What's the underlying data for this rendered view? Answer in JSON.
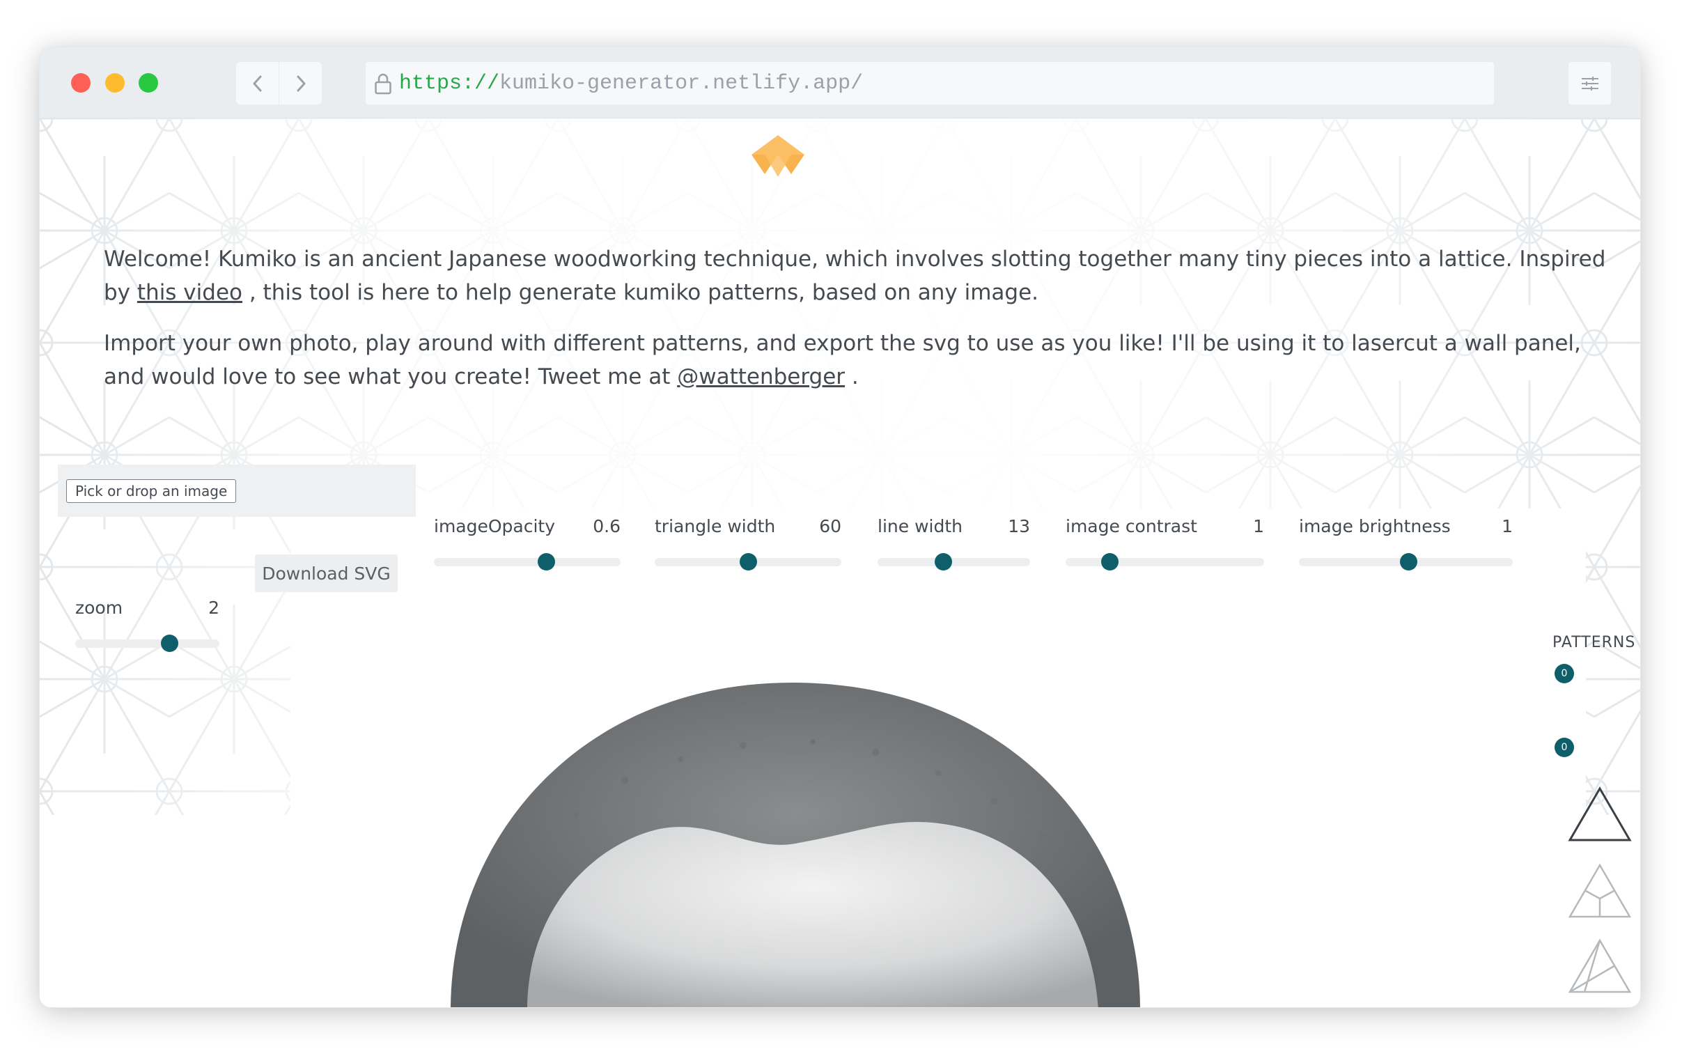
{
  "browser": {
    "url_scheme": "https://",
    "url_host": "kumiko-generator.netlify.app/"
  },
  "intro": {
    "p1_before_link": "Welcome! Kumiko is an ancient Japanese woodworking technique, which involves slotting together many tiny pieces into a lattice. Inspired by ",
    "p1_link": "this video",
    "p1_after_link": " , this tool is here to help generate kumiko patterns, based on any image.",
    "p2_before_link": "Import your own photo, play around with different patterns, and export the svg to use as you like! I'll be using it to lasercut a wall panel, and would love to see what you create! Tweet me at ",
    "p2_link": "@wattenberger",
    "p2_after_link": " ."
  },
  "controls": {
    "pick_image_label": "Pick or drop an image",
    "download_label": "Download SVG",
    "sliders": {
      "image_opacity": {
        "label": "imageOpacity",
        "value": "0.6",
        "fraction": 0.6
      },
      "triangle_width": {
        "label": "triangle width",
        "value": "60",
        "fraction": 0.5
      },
      "line_width": {
        "label": "line width",
        "value": "13",
        "fraction": 0.43
      },
      "image_contrast": {
        "label": "image contrast",
        "value": "1",
        "fraction": 0.22
      },
      "image_brightness": {
        "label": "image brightness",
        "value": "1",
        "fraction": 0.51
      },
      "zoom": {
        "label": "zoom",
        "value": "2",
        "fraction": 0.65
      }
    }
  },
  "patterns": {
    "title": "PATTERNS",
    "count_badge": "0",
    "selected_badge": "0",
    "options": [
      "triangle-plain",
      "triangle-y-split",
      "triangle-inner",
      "triangle-small"
    ]
  },
  "colors": {
    "accent": "#0f5f6b",
    "logo_light": "#fbc065",
    "logo_dark": "#f8ab3b",
    "text": "#444a4f",
    "pattern_line": "#e3e7ea"
  }
}
